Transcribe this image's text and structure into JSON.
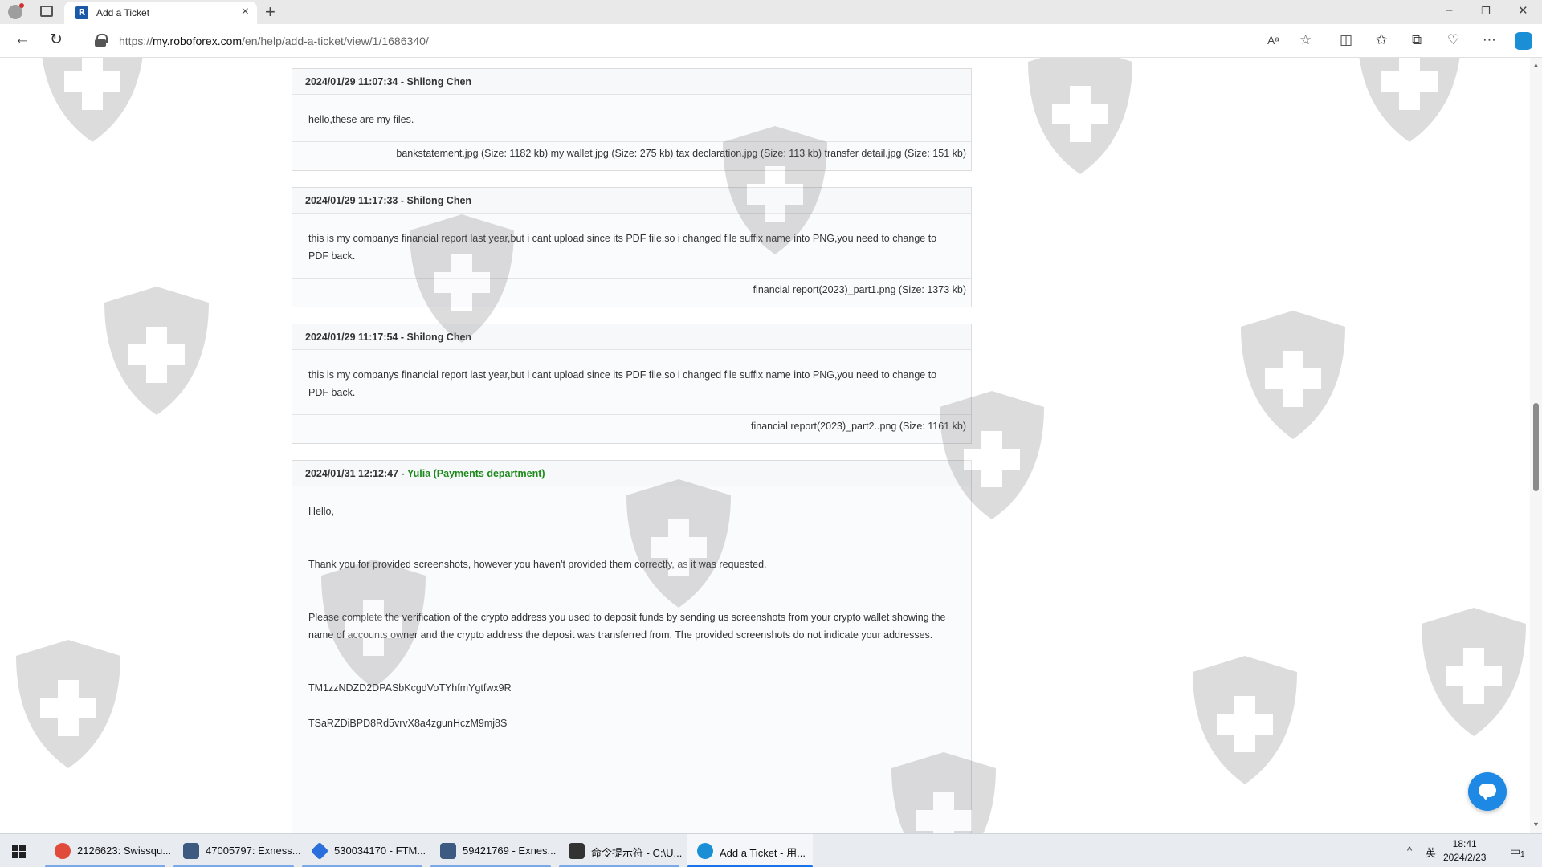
{
  "browser": {
    "tab_title": "Add a Ticket",
    "tab_favicon": "R",
    "new_tab_glyph": "+",
    "url_prefix": "https://",
    "url_domain": "my.roboforex.com",
    "url_path": "/en/help/add-a-ticket/view/1/1686340/",
    "window_minimize": "–",
    "window_restore": "❐",
    "window_close": "✕"
  },
  "thread": {
    "messages": [
      {
        "timestamp": "2024/01/29 11:07:34",
        "separator": " - ",
        "author": "Shilong Chen",
        "staff": false,
        "paragraphs": [
          "hello,these are my files."
        ],
        "files": "bankstatement.jpg (Size: 1182 kb) my wallet.jpg (Size: 275 kb) tax declaration.jpg (Size: 113 kb) transfer detail.jpg (Size: 151 kb)"
      },
      {
        "timestamp": "2024/01/29 11:17:33",
        "separator": " - ",
        "author": "Shilong Chen",
        "staff": false,
        "paragraphs": [
          "this is my companys  financial report last year,but i cant upload since its PDF file,so i changed  file suffix name into PNG,you need to change to PDF back."
        ],
        "files": "financial report(2023)_part1.png (Size: 1373 kb)"
      },
      {
        "timestamp": "2024/01/29 11:17:54",
        "separator": " - ",
        "author": "Shilong Chen",
        "staff": false,
        "paragraphs": [
          "this is my companys  financial report last year,but i cant upload since its PDF file,so i changed  file suffix name into PNG,you need to change to PDF back."
        ],
        "files": "financial report(2023)_part2..png (Size: 1161 kb)"
      },
      {
        "timestamp": "2024/01/31 12:12:47",
        "separator": " - ",
        "author": "Yulia (Payments department)",
        "staff": true,
        "greeting": "Hello,",
        "p1": "Thank you for provided screenshots, however you haven't provided them correctly, as it was requested.",
        "p2": "Please complete the verification of the crypto address you used to deposit funds by sending us screenshots from your crypto wallet showing the name of accounts owner and the crypto address the deposit was transferred from. The provided screenshots do not indicate your addresses.",
        "address1": "TM1zzNDZD2DPASbKcgdVoTYhfmYgtfwx9R",
        "address2": "TSaRZDiBPD8Rd5vrvX8a4zgunHczM9mj8S"
      }
    ]
  },
  "taskbar": {
    "apps": [
      {
        "label": "2126623: Swissqu...",
        "icon": "swissquote-icon",
        "color": "#e04b3c"
      },
      {
        "label": "47005797: Exness...",
        "icon": "exness-mt-icon",
        "color": "#3d5a80"
      },
      {
        "label": "530034170 - FTM...",
        "icon": "ftmo-icon",
        "color": "#2a6fdb"
      },
      {
        "label": "59421769 - Exnes...",
        "icon": "exness-mt-icon",
        "color": "#3d5a80"
      },
      {
        "label": "命令提示符 - C:\\U...",
        "icon": "cmd-icon",
        "color": "#333333"
      },
      {
        "label": "Add a Ticket - 用...",
        "icon": "edge-icon",
        "color": "#1a8fd6"
      }
    ],
    "tray_up": "^",
    "ime": "英",
    "time": "18:41",
    "date": "2024/2/23",
    "notification_count": "1"
  }
}
